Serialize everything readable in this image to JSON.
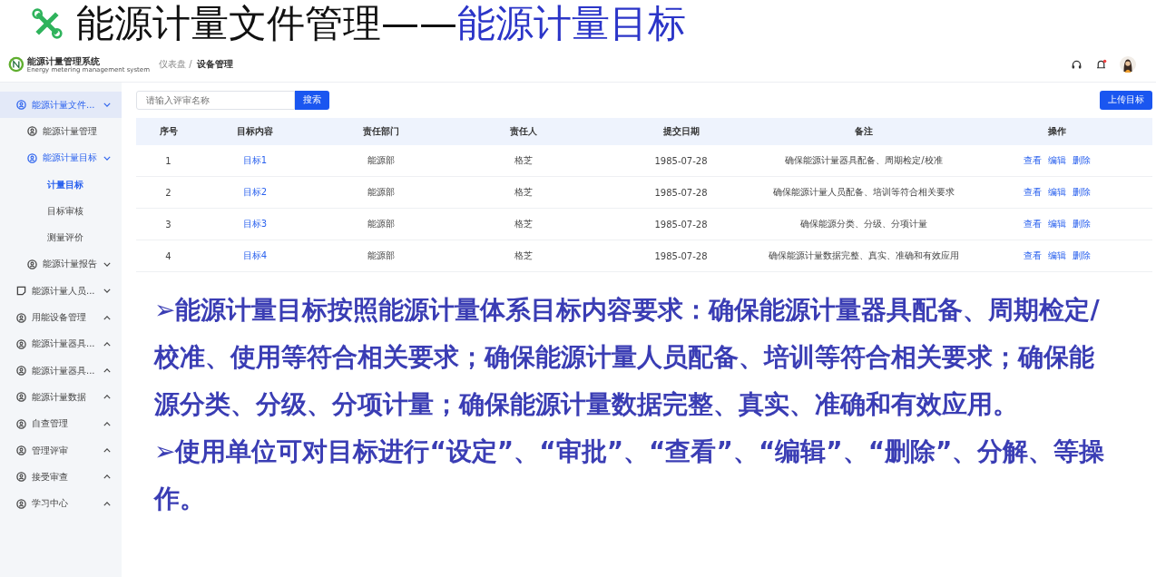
{
  "slide_title": {
    "prefix": "能源计量文件管理——",
    "highlight": "能源计量目标"
  },
  "app": {
    "logo": {
      "name": "能源计量管理系统",
      "subtitle": "Energy metering management system"
    },
    "breadcrumb": [
      {
        "label": "仪表盘 /",
        "current": false
      },
      {
        "label": "设备管理",
        "current": true
      }
    ],
    "has_notifications": true,
    "sidebar": [
      {
        "label": "能源计量文件...",
        "kind": "user",
        "expanded": true,
        "selected": true,
        "children": [
          {
            "label": "能源计量管理",
            "kind": "user",
            "selected": false
          },
          {
            "label": "能源计量目标",
            "kind": "user",
            "expanded": true,
            "selected": true,
            "children": [
              {
                "label": "计量目标",
                "selected": true
              },
              {
                "label": "目标审核",
                "selected": false
              },
              {
                "label": "测量评价",
                "selected": false
              }
            ]
          },
          {
            "label": "能源计量报告",
            "kind": "user",
            "expanded": true,
            "selected": false
          }
        ]
      },
      {
        "label": "能源计量人员...",
        "kind": "note",
        "expanded": true,
        "selected": false
      },
      {
        "label": "用能设备管理",
        "kind": "user",
        "expanded": false,
        "selected": false
      },
      {
        "label": "能源计量器具...",
        "kind": "user",
        "expanded": false,
        "selected": false
      },
      {
        "label": "能源计量器具...",
        "kind": "user",
        "expanded": false,
        "selected": false
      },
      {
        "label": "能源计量数据",
        "kind": "user",
        "expanded": false,
        "selected": false
      },
      {
        "label": "自查管理",
        "kind": "user",
        "expanded": false,
        "selected": false
      },
      {
        "label": "管理评审",
        "kind": "user",
        "expanded": false,
        "selected": false
      },
      {
        "label": "接受审查",
        "kind": "user",
        "expanded": false,
        "selected": false
      },
      {
        "label": "学习中心",
        "kind": "user",
        "expanded": false,
        "selected": false
      }
    ],
    "search": {
      "placeholder": "请输入评审名称",
      "button": "搜索"
    },
    "upload_button": "上传目标",
    "table": {
      "columns": [
        "序号",
        "目标内容",
        "责任部门",
        "责任人",
        "提交日期",
        "备注",
        "操作"
      ],
      "rows": [
        {
          "index": "1",
          "target": "目标1",
          "department": "能源部",
          "person": "格芝",
          "date": "1985-07-28",
          "note": "确保能源计量器具配备、周期检定/校准",
          "actions": [
            "查看",
            "编辑",
            "删除"
          ]
        },
        {
          "index": "2",
          "target": "目标2",
          "department": "能源部",
          "person": "格芝",
          "date": "1985-07-28",
          "note": "确保能源计量人员配备、培训等符合相关要求",
          "actions": [
            "查看",
            "编辑",
            "删除"
          ]
        },
        {
          "index": "3",
          "target": "目标3",
          "department": "能源部",
          "person": "格芝",
          "date": "1985-07-28",
          "note": "确保能源分类、分级、分项计量",
          "actions": [
            "查看",
            "编辑",
            "删除"
          ]
        },
        {
          "index": "4",
          "target": "目标4",
          "department": "能源部",
          "person": "格芝",
          "date": "1985-07-28",
          "note": "确保能源计量数据完整、真实、准确和有效应用",
          "actions": [
            "查看",
            "编辑",
            "删除"
          ]
        }
      ]
    }
  },
  "callout": [
    "➢能源计量目标按照能源计量体系目标内容要求：确保能源计量器具配备、周期检定/校准、使用等符合相关要求；确保能源计量人员配备、培训等符合相关要求；确保能源分类、分级、分项计量；确保能源计量数据完整、真实、准确和有效应用。",
    "➢使用单位可对目标进行“设定”、“审批”、“查看”、“编辑”、“删除”、分解、等操作。"
  ]
}
